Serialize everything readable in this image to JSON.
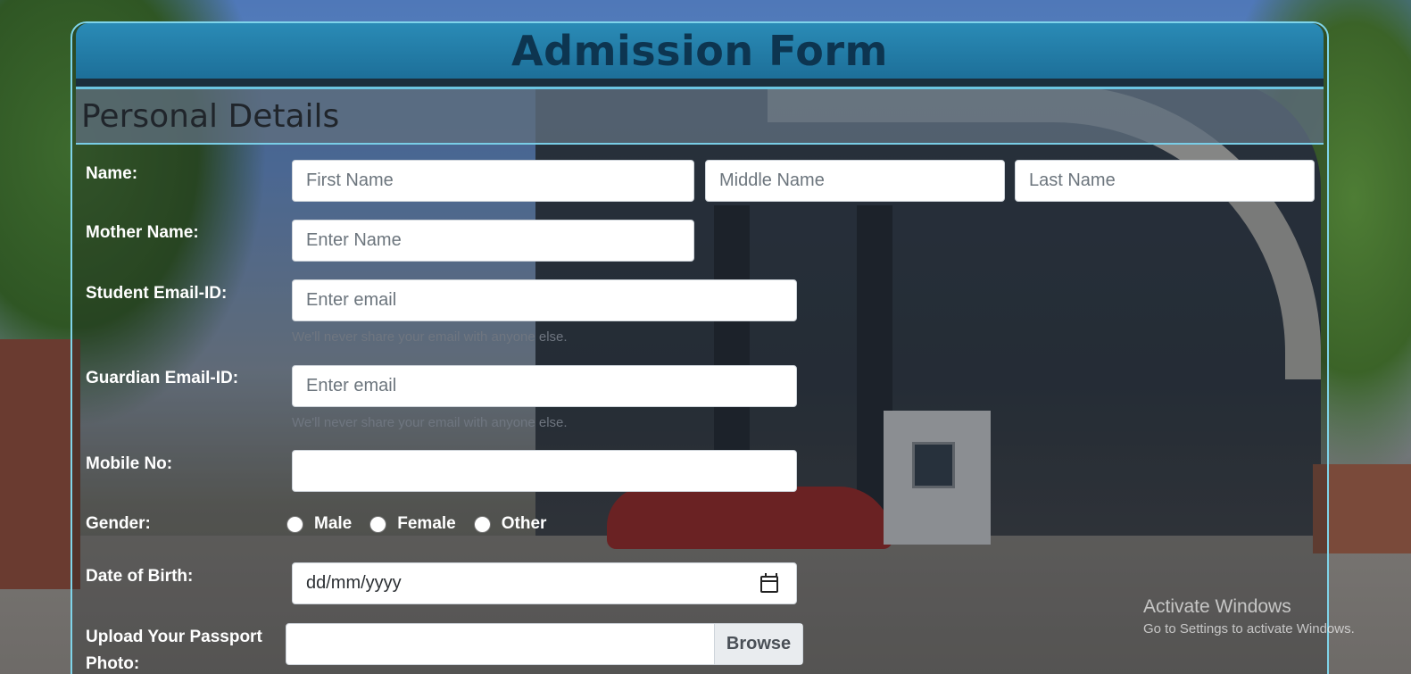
{
  "header": {
    "title": "Admission Form"
  },
  "section": {
    "title": "Personal Details"
  },
  "form": {
    "name": {
      "label": "Name:",
      "first_placeholder": "First Name",
      "middle_placeholder": "Middle Name",
      "last_placeholder": "Last Name"
    },
    "mother": {
      "label": "Mother Name:",
      "placeholder": "Enter Name"
    },
    "student_email": {
      "label": "Student Email-ID:",
      "placeholder": "Enter email",
      "help": "We'll never share your email with anyone else."
    },
    "guardian_email": {
      "label": "Guardian Email-ID:",
      "placeholder": "Enter email",
      "help": "We'll never share your email with anyone else."
    },
    "mobile": {
      "label": "Mobile No:",
      "value": ""
    },
    "gender": {
      "label": "Gender:",
      "options": [
        "Male",
        "Female",
        "Other"
      ]
    },
    "dob": {
      "label": "Date of Birth:",
      "placeholder": "dd/mm/yyyy"
    },
    "photo": {
      "label_line1": "Upload Your Passport",
      "label_line2": "Photo:",
      "button": "Browse"
    }
  },
  "watermark": {
    "title": "Activate Windows",
    "subtitle": "Go to Settings to activate Windows."
  },
  "colors": {
    "header_bg": "#2a8bb6",
    "header_text": "#0d3550",
    "border_accent": "#7fd4ea"
  }
}
